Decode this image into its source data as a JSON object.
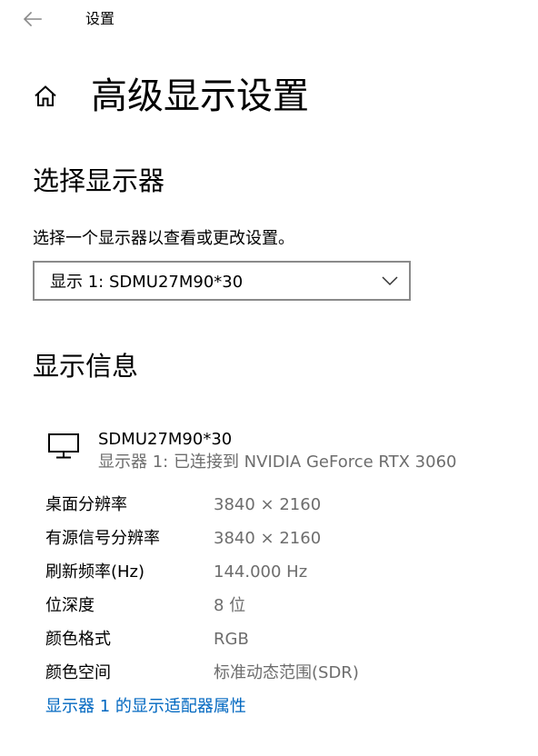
{
  "header": {
    "back_icon": "back-arrow-icon",
    "app_title": "设置"
  },
  "page": {
    "home_icon": "home-icon",
    "title": "高级显示设置"
  },
  "select_display": {
    "section_title": "选择显示器",
    "description": "选择一个显示器以查看或更改设置。",
    "dropdown": {
      "selected": "显示 1: SDMU27M90*30",
      "icon": "chevron-down-icon"
    }
  },
  "display_info": {
    "section_title": "显示信息",
    "monitor_icon": "monitor-icon",
    "monitor_name": "SDMU27M90*30",
    "monitor_subtitle": "显示器 1: 已连接到 NVIDIA GeForce RTX 3060",
    "properties": [
      {
        "label": "桌面分辨率",
        "value": "3840 × 2160"
      },
      {
        "label": "有源信号分辨率",
        "value": "3840 × 2160"
      },
      {
        "label": "刷新频率(Hz)",
        "value": "144.000 Hz"
      },
      {
        "label": "位深度",
        "value": "8 位"
      },
      {
        "label": "颜色格式",
        "value": "RGB"
      },
      {
        "label": "颜色空间",
        "value": "标准动态范围(SDR)"
      }
    ],
    "adapter_link": "显示器 1 的显示适配器属性"
  },
  "colors": {
    "link": "#0067c0",
    "secondary_text": "#6d6d6d",
    "dropdown_border": "#8a8a8a"
  }
}
